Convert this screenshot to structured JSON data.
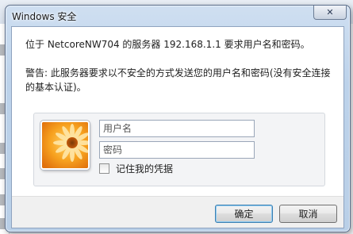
{
  "dialog": {
    "title": "Windows 安全",
    "close_icon": "close-icon",
    "message": "位于 NetcoreNW704 的服务器 192.168.1.1 要求用户名和密码。",
    "warning": "警告: 此服务器要求以不安全的方式发送您的用户名和密码(没有安全连接的基本认证)。",
    "username_placeholder": "用户名",
    "password_placeholder": "密码",
    "remember_label": "记住我的凭据",
    "remember_checked": false,
    "avatar_icon": "user-flower-avatar",
    "ok_label": "确定",
    "cancel_label": "取消"
  },
  "colors": {
    "frame": "#bcd2ea",
    "panel": "#f3f4f6",
    "avatar_orange": "#f39a1c",
    "default_button_border": "#3c7fb1"
  }
}
